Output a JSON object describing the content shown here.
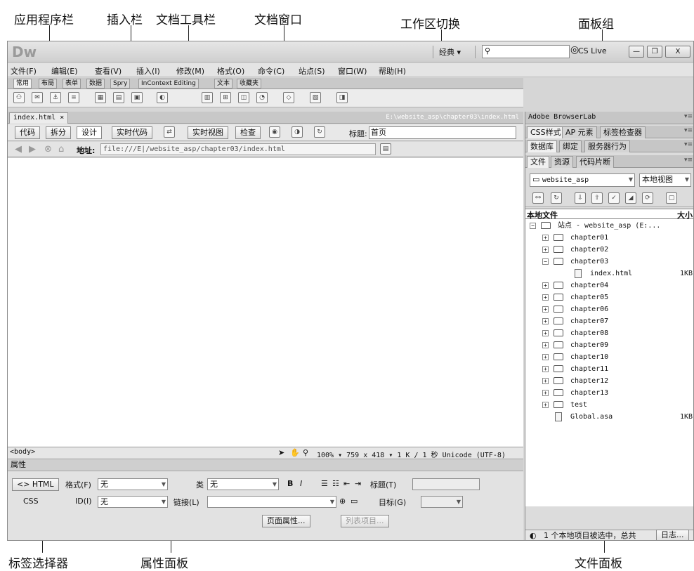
{
  "callouts": {
    "app_bar": "应用程序栏",
    "insert_bar": "插入栏",
    "doc_toolbar": "文档工具栏",
    "doc_window": "文档窗口",
    "workspace_switch": "工作区切换",
    "panel_group": "面板组",
    "tag_selector": "标签选择器",
    "props_panel": "属性面板",
    "files_panel": "文件面板"
  },
  "titlebar": {
    "logo": "Dw",
    "workspace": "经典 ▾",
    "cslive": "CS Live",
    "win_min": "—",
    "win_restore": "❐",
    "win_close": "X"
  },
  "menus": [
    "文件(F)",
    "编辑(E)",
    "查看(V)",
    "插入(I)",
    "修改(M)",
    "格式(O)",
    "命令(C)",
    "站点(S)",
    "窗口(W)",
    "帮助(H)"
  ],
  "insert_tabs": [
    "常用",
    "布局",
    "表单",
    "数据",
    "Spry",
    "InContext Editing",
    "文本",
    "收藏夹"
  ],
  "document": {
    "tab": "index.html ×",
    "path": "E:\\website_asp\\chapter03\\index.html",
    "view_buttons": [
      "代码",
      "拆分",
      "设计"
    ],
    "live_code": "实时代码",
    "live_view": "实时视图",
    "inspect": "检查",
    "title_label": "标题:",
    "title_value": "首页",
    "address_label": "地址:",
    "address_value": "file:///E|/website_asp/chapter03/index.html",
    "tag": "<body>",
    "status": "100%  ▾ 759 x 418 ▾ 1 K / 1 秒 Unicode (UTF-8)"
  },
  "properties": {
    "header": "属性",
    "html_btn": "<> HTML",
    "css_btn": "CSS",
    "format_label": "格式(F)",
    "format_value": "无",
    "class_label": "类",
    "class_value": "无",
    "id_label": "ID(I)",
    "id_value": "无",
    "link_label": "链接(L)",
    "title_label": "标题(T)",
    "target_label": "目标(G)",
    "page_props": "页面属性...",
    "list_item": "列表项目..."
  },
  "panels": {
    "browserlab": "Adobe BrowserLab",
    "group2_tabs": [
      "CSS样式",
      "AP 元素",
      "标签检查器"
    ],
    "group3_tabs": [
      "数据库",
      "绑定",
      "服务器行为"
    ],
    "group4_tabs": [
      "文件",
      "资源",
      "代码片断"
    ],
    "site_select": "website_asp",
    "view_select": "本地视图",
    "col_files": "本地文件",
    "col_size": "大小",
    "root": "站点 - website_asp (E:...",
    "status": "1 个本地项目被选中，总共",
    "log_btn": "日志..."
  },
  "files": [
    {
      "name": "chapter01",
      "size": ""
    },
    {
      "name": "chapter02",
      "size": ""
    },
    {
      "name": "chapter03",
      "size": ""
    },
    {
      "name": "index.html",
      "size": "1KB"
    },
    {
      "name": "chapter04",
      "size": ""
    },
    {
      "name": "chapter05",
      "size": ""
    },
    {
      "name": "chapter06",
      "size": ""
    },
    {
      "name": "chapter07",
      "size": ""
    },
    {
      "name": "chapter08",
      "size": ""
    },
    {
      "name": "chapter09",
      "size": ""
    },
    {
      "name": "chapter10",
      "size": ""
    },
    {
      "name": "chapter11",
      "size": ""
    },
    {
      "name": "chapter12",
      "size": ""
    },
    {
      "name": "chapter13",
      "size": ""
    },
    {
      "name": "test",
      "size": ""
    },
    {
      "name": "Global.asa",
      "size": "1KB"
    }
  ]
}
